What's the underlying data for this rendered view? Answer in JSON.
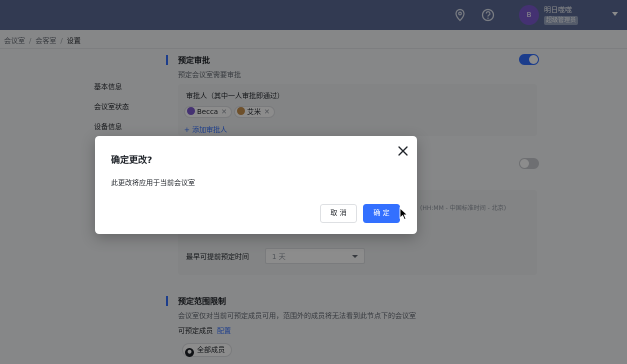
{
  "topbar": {
    "icons": [
      "location-pin-icon",
      "help-circle-icon"
    ],
    "user_avatar_text": "B",
    "user_name": "明日噬噬",
    "user_role": "超级管理员",
    "colors": {
      "bar": "#5b6b96",
      "avatar": "#7d5ad0"
    }
  },
  "breadcrumb": {
    "items": [
      "会议室",
      "会客室",
      "设置"
    ]
  },
  "leftnav": {
    "items": [
      "基本信息",
      "会议室状态",
      "设备信息"
    ]
  },
  "approval": {
    "title": "预定审批",
    "desc": "预定会议室需要审批",
    "toggle_on": true,
    "approvers_label": "审批人（其中一人审批即通过）",
    "approvers": [
      {
        "name": "Becca",
        "avatar_color": "#7d5ad0"
      },
      {
        "name": "艾米",
        "avatar_color": "#c9924f"
      }
    ],
    "add_approver": "+ 添加审批人"
  },
  "rules": {
    "toggle_on": false,
    "side_hint": "(HH:MM - 中国标准时间 - 北京)",
    "advance_label": "最早可提前预定时间",
    "advance_value": "1 天"
  },
  "scope": {
    "title": "预定范围限制",
    "desc": "会议室仅对当前可预定成员可用，范围外的成员将无法看到此节点下的会议室",
    "who_label": "可预定成员",
    "config_link": "配置",
    "member": "全部成员"
  },
  "dialog": {
    "title": "确定更改?",
    "body": "此更改将应用于当前会议室",
    "cancel_label": "取 消",
    "ok_label": "确 定",
    "accent": "#3370ff"
  }
}
